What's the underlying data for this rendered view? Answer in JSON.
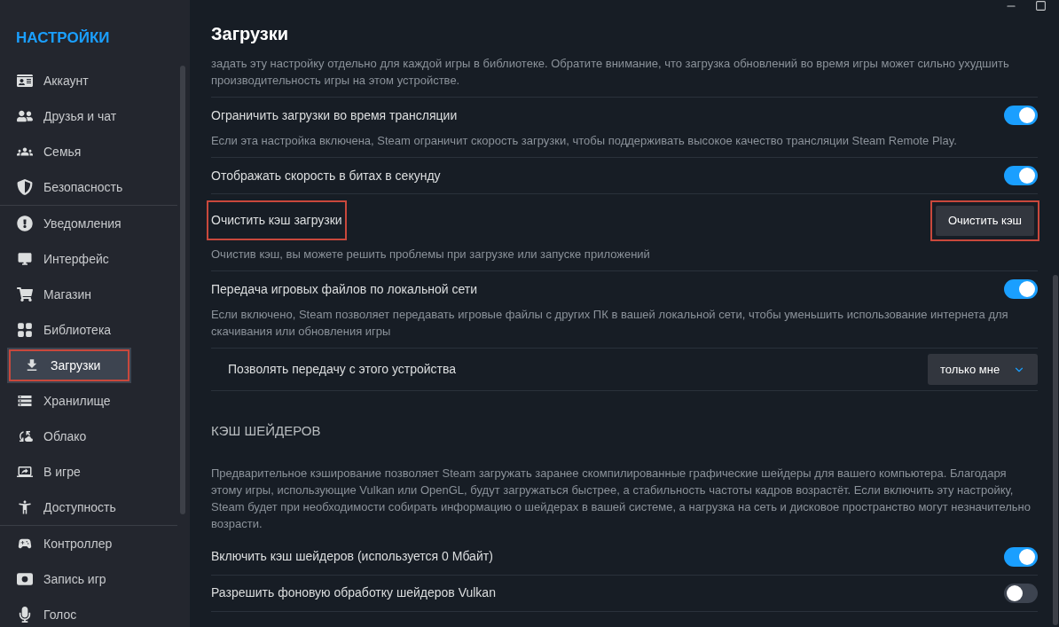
{
  "sidebar": {
    "title": "НАСТРОЙКИ",
    "groups": [
      [
        {
          "label": "Аккаунт",
          "selected": false,
          "highlighted": false
        },
        {
          "label": "Друзья и чат",
          "selected": false,
          "highlighted": false
        },
        {
          "label": "Семья",
          "selected": false,
          "highlighted": false
        },
        {
          "label": "Безопасность",
          "selected": false,
          "highlighted": false
        }
      ],
      [
        {
          "label": "Уведомления",
          "selected": false,
          "highlighted": false
        },
        {
          "label": "Интерфейс",
          "selected": false,
          "highlighted": false
        },
        {
          "label": "Магазин",
          "selected": false,
          "highlighted": false
        },
        {
          "label": "Библиотека",
          "selected": false,
          "highlighted": false
        },
        {
          "label": "Загрузки",
          "selected": true,
          "highlighted": true
        },
        {
          "label": "Хранилище",
          "selected": false,
          "highlighted": false
        },
        {
          "label": "Облако",
          "selected": false,
          "highlighted": false
        },
        {
          "label": "В игре",
          "selected": false,
          "highlighted": false
        },
        {
          "label": "Доступность",
          "selected": false,
          "highlighted": false
        }
      ],
      [
        {
          "label": "Контроллер",
          "selected": false,
          "highlighted": false
        },
        {
          "label": "Запись игр",
          "selected": false,
          "highlighted": false
        },
        {
          "label": "Голос",
          "selected": false,
          "highlighted": false
        }
      ]
    ]
  },
  "page": {
    "title": "Загрузки",
    "top_description": "задать эту настройку отдельно для каждой игры в библиотеке. Обратите внимание, что загрузка обновлений во время игры может сильно ухудшить производительность игры на этом устройстве.",
    "settings": [
      {
        "kind": "toggle",
        "label": "Ограничить загрузки во время трансляции",
        "highlighted": false,
        "on": true,
        "description": "Если эта настройка включена, Steam ограничит скорость загрузки, чтобы поддерживать высокое качество трансляции Steam Remote Play."
      },
      {
        "kind": "toggle",
        "label": "Отображать скорость в битах в секунду",
        "highlighted": false,
        "on": true
      },
      {
        "kind": "button",
        "label": "Очистить кэш загрузки",
        "highlighted": true,
        "button": {
          "label": "Очистить кэш",
          "highlighted": true
        },
        "description": "Очистив кэш, вы можете решить проблемы при загрузке или запуске приложений"
      },
      {
        "kind": "toggle",
        "label": "Передача игровых файлов по локальной сети",
        "highlighted": false,
        "on": true,
        "description": "Если включено, Steam позволяет передавать игровые файлы с других ПК в вашей локальной сети, чтобы уменьшить использование интернета для скачивания или обновления игры"
      },
      {
        "kind": "dropdown",
        "label": "Позволять передачу с этого устройства",
        "highlighted": false,
        "value": "только мне"
      }
    ],
    "section": {
      "title": "КЭШ ШЕЙДЕРОВ",
      "description": "Предварительное кэширование позволяет Steam загружать заранее скомпилированные графические шейдеры для вашего компьютера. Благодаря этому игры, использующие Vulkan или OpenGL, будут загружаться быстрее, а стабильность частоты кадров возрастёт. Если включить эту настройку, Steam будет при необходимости собирать информацию о шейдерах в вашей системе, а нагрузка на сеть и дисковое пространство могут незначительно возрасти.",
      "settings": [
        {
          "kind": "toggle",
          "label": "Включить кэш шейдеров (используется 0 Мбайт)",
          "highlighted": false,
          "on": true
        },
        {
          "kind": "toggle",
          "label": "Разрешить фоновую обработку шейдеров Vulkan",
          "highlighted": false,
          "on": false
        }
      ]
    }
  }
}
